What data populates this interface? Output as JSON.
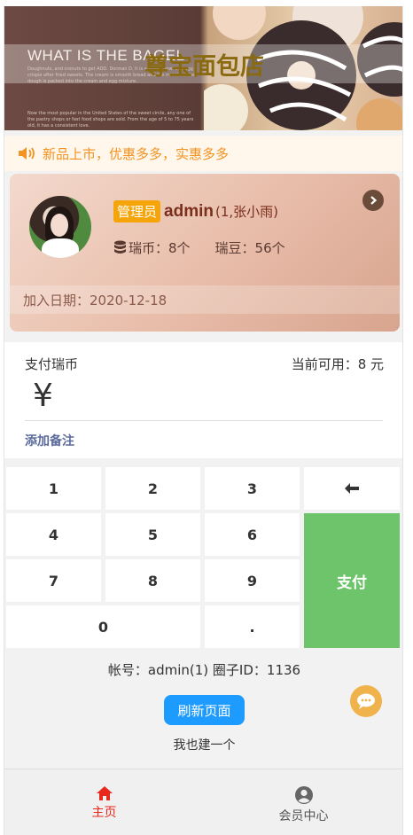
{
  "banner": {
    "shop_title": "尊宝面包店",
    "overlay_text": "WHAT IS THE BAGEL",
    "para_top": "Doughnuts, and cronuts to get ADD. Dorman D. It is a mixed bowl and egg crispie after fried sweets. The cream is smooth bread and the middle of the dough is packed into the cream and egg mixture.",
    "para_bottom": "Now the most popular in the United States of the sweet circle, any one of the pastry shops or fast food shops are sold. From the age of 5 to 75 years old, it has a consistent love."
  },
  "notice": {
    "text": "新品上市，优惠多多，实惠多多",
    "icon": "speaker-icon"
  },
  "member": {
    "role": "管理员",
    "username": "admin",
    "info": "(1,张小雨)",
    "coins": "瑞币：8个",
    "beans": "瑞豆：56个",
    "join_date": "加入日期：2020-12-18"
  },
  "payment": {
    "label": "支付瑞币",
    "available": "当前可用：8 元",
    "currency": "¥",
    "amount_value": "",
    "remark": "添加备注"
  },
  "keypad": {
    "k1": "1",
    "k2": "2",
    "k3": "3",
    "k4": "4",
    "k5": "5",
    "k6": "6",
    "k7": "7",
    "k8": "8",
    "k9": "9",
    "k0": "0",
    "dot": ".",
    "back_icon": "backspace-arrow-icon",
    "pay": "支付"
  },
  "footer": {
    "account": "帐号：admin(1) 圈子ID：1136",
    "refresh": "刷新页面",
    "build": "我也建一个"
  },
  "tabs": {
    "home": "主页",
    "member": "会员中心"
  },
  "colors": {
    "accent_orange": "#f29322",
    "pay_green": "#6ec46a",
    "refresh_blue": "#1e9bff",
    "home_red": "#e8281c",
    "role_badge": "#f5a50a",
    "chat_bubble": "#f0b24a"
  }
}
